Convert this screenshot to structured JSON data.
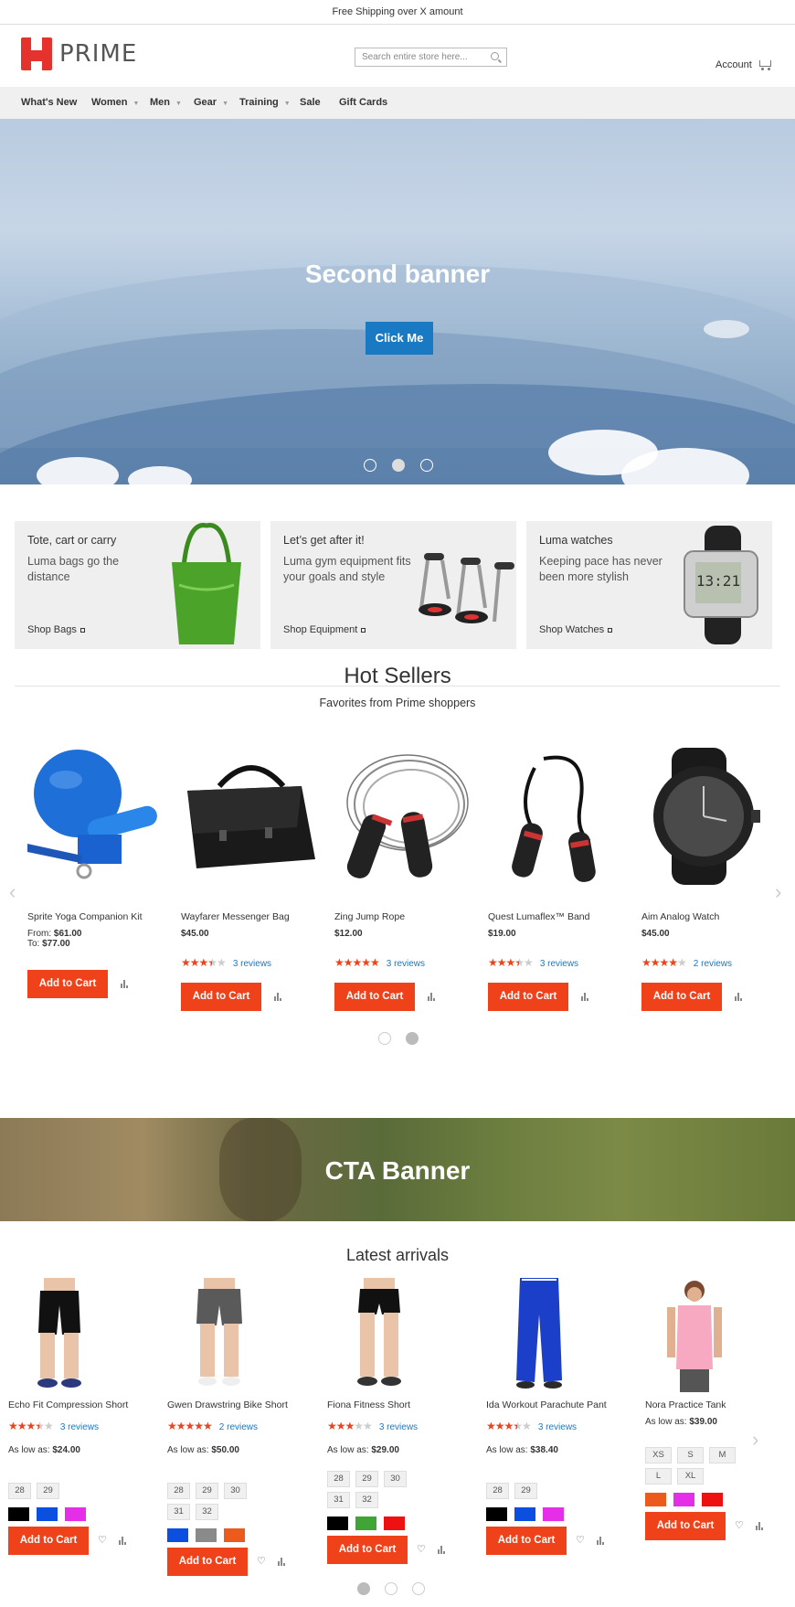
{
  "topbar": {
    "text": "Free Shipping over X amount"
  },
  "header": {
    "logo_text": "PRIME",
    "search_placeholder": "Search entire store here...",
    "account_label": "Account"
  },
  "nav": [
    {
      "label": "What's New",
      "caret": false
    },
    {
      "label": "Women",
      "caret": true
    },
    {
      "label": "Men",
      "caret": true
    },
    {
      "label": "Gear",
      "caret": true
    },
    {
      "label": "Training",
      "caret": true
    },
    {
      "label": "Sale",
      "caret": false
    },
    {
      "label": "Gift Cards",
      "caret": false
    }
  ],
  "hero": {
    "title": "Second banner",
    "button": "Click Me",
    "dots": 3,
    "active_dot": 2
  },
  "promos": [
    {
      "title": "Tote, cart or carry",
      "text": "Luma bags go the distance",
      "link": "Shop Bags"
    },
    {
      "title": "Let’s get after it!",
      "text": "Luma gym equipment fits your goals and style",
      "link": "Shop Equipment"
    },
    {
      "title": "Luma watches",
      "text": "Keeping pace has never been more stylish",
      "link": "Shop Watches"
    }
  ],
  "hot_sellers": {
    "title": "Hot Sellers",
    "subtitle": "Favorites from Prime shoppers",
    "products": [
      {
        "name": "Sprite Yoga Companion Kit",
        "from_label": "From:",
        "from_price": "$61.00",
        "to_label": "To:",
        "to_price": "$77.00",
        "rating": 0,
        "reviews": "",
        "button": "Add to Cart"
      },
      {
        "name": "Wayfarer Messenger Bag",
        "price": "$45.00",
        "rating": 3.5,
        "reviews": "3 reviews",
        "button": "Add to Cart"
      },
      {
        "name": "Zing Jump Rope",
        "price": "$12.00",
        "rating": 5,
        "reviews": "3 reviews",
        "button": "Add to Cart"
      },
      {
        "name": "Quest Lumaflex™ Band",
        "price": "$19.00",
        "rating": 3.5,
        "reviews": "3 reviews",
        "button": "Add to Cart"
      },
      {
        "name": "Aim Analog Watch",
        "price": "$45.00",
        "rating": 4,
        "reviews": "2 reviews",
        "button": "Add to Cart"
      }
    ],
    "dots": 2,
    "active_dot": 2
  },
  "cta": {
    "title": "CTA Banner"
  },
  "latest": {
    "title": "Latest arrivals",
    "products": [
      {
        "name": "Echo Fit Compression Short",
        "rating": 3.5,
        "reviews": "3 reviews",
        "price_label": "As low as:",
        "price": "$24.00",
        "sizes": [
          "28",
          "29"
        ],
        "colors": [
          "#000000",
          "#0b4fe0",
          "#e52ee8"
        ],
        "button": "Add to Cart"
      },
      {
        "name": "Gwen Drawstring Bike Short",
        "rating": 5,
        "reviews": "2 reviews",
        "price_label": "As low as:",
        "price": "$50.00",
        "sizes": [
          "28",
          "29",
          "30",
          "31",
          "32"
        ],
        "colors": [
          "#0b4fe0",
          "#8a8a8a",
          "#ed5b1c"
        ],
        "button": "Add to Cart"
      },
      {
        "name": "Fiona Fitness Short",
        "rating": 3,
        "reviews": "3 reviews",
        "price_label": "As low as:",
        "price": "$29.00",
        "sizes": [
          "28",
          "29",
          "30",
          "31",
          "32"
        ],
        "colors": [
          "#000000",
          "#3fa535",
          "#ee1111"
        ],
        "button": "Add to Cart"
      },
      {
        "name": "Ida Workout Parachute Pant",
        "rating": 3.5,
        "reviews": "3 reviews",
        "price_label": "As low as:",
        "price": "$38.40",
        "sizes": [
          "28",
          "29"
        ],
        "colors": [
          "#000000",
          "#0b4fe0",
          "#e52ee8"
        ],
        "button": "Add to Cart"
      },
      {
        "name": "Nora Practice Tank",
        "rating": 0,
        "reviews": "",
        "price_label": "As low as:",
        "price": "$39.00",
        "sizes": [
          "XS",
          "S",
          "M",
          "L",
          "XL"
        ],
        "colors": [
          "#ed5b1c",
          "#e52ee8",
          "#ee1111"
        ],
        "button": "Add to Cart"
      }
    ],
    "dots": 3,
    "active_dot": 1
  },
  "colors": {
    "accent": "#f0421a",
    "primary_button": "#1979c3",
    "link": "#1979c3"
  }
}
